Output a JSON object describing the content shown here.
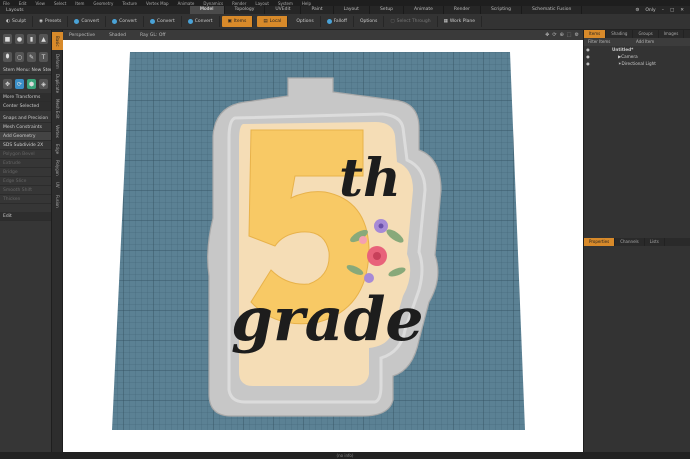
{
  "menubar": [
    "File",
    "Edit",
    "View",
    "Select",
    "Item",
    "Geometry",
    "Texture",
    "Vertex Map",
    "Animate",
    "Dynamics",
    "Render",
    "Layout",
    "System",
    "Help"
  ],
  "tabbar": {
    "app_title": "Layouts",
    "tabs": [
      {
        "label": "Model",
        "active": true
      },
      {
        "label": "Topology",
        "active": false
      },
      {
        "label": "UVEdit",
        "active": false
      },
      {
        "label": "Paint",
        "active": false
      },
      {
        "label": "Layout",
        "active": false
      },
      {
        "label": "Setup",
        "active": false
      },
      {
        "label": "Animate",
        "active": false
      },
      {
        "label": "Render",
        "active": false
      },
      {
        "label": "Scripting",
        "active": false
      },
      {
        "label": "Schematic Fusion",
        "active": false
      }
    ],
    "right_label": "Only"
  },
  "toolbar": {
    "sculpt": "Sculpt",
    "presets": "Presets",
    "convert_1": "Convert",
    "convert_2": "Convert",
    "convert_3": "Convert",
    "convert_4": "Convert",
    "items": "Items",
    "local": "Local",
    "options_1": "Options",
    "falloff": "Falloff",
    "options_2": "Options",
    "select_through": "Select Through",
    "work_plane": "Work Plane"
  },
  "left_panel": {
    "stem_menu": "Stem Menu: New Stem",
    "more_transforms": "More Transforms",
    "center_selected": "Center Selected",
    "snaps": "Snaps and Precision",
    "mesh_constraints": "Mesh Constraints",
    "add_geometry": "Add Geometry",
    "sds_subdivide": "SDS Subdivide 2X",
    "dim_items": [
      "Polygon Bevel",
      "Extrude",
      "Bridge",
      "Edge Slice",
      "Smooth Shift",
      "Thicken"
    ],
    "edit": "Edit"
  },
  "vert_tabs": [
    "Basic",
    "Deform",
    "Duplicate",
    "Mesh Edit",
    "Vertex",
    "Edge",
    "Polygon",
    "UV",
    "Fusion"
  ],
  "viewport": {
    "perspective": "Perspective",
    "shaded": "Shaded",
    "ray_gl": "Ray GL: Off"
  },
  "artwork": {
    "numeral": "5",
    "suffix": "th",
    "word": "grade",
    "colors": {
      "grid": "#5b8194",
      "gridline": "#3e6172",
      "plate": "#c7c7c7",
      "wood": "#f5ddb6",
      "yellow": "#f8c965",
      "ink": "#1d1d1d",
      "flower_pink": "#e8627a",
      "flower_purple": "#a78ad6",
      "leaf": "#88a97a"
    }
  },
  "right_panel": {
    "tabs": [
      "Items",
      "Shading",
      "Groups",
      "Images"
    ],
    "filter": "Filter Items",
    "add_item": "Add Item",
    "items": [
      "Untitled*",
      "Camera",
      "Directional Light"
    ],
    "bottom_tabs": [
      "Properties",
      "Channels",
      "Lists"
    ]
  },
  "status": "(no info)"
}
